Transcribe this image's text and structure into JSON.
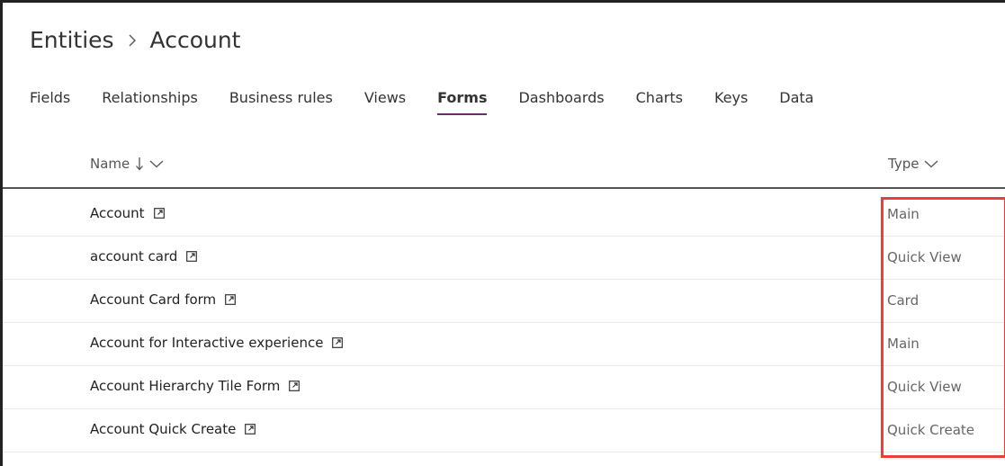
{
  "breadcrumb": {
    "root": "Entities",
    "current": "Account"
  },
  "tabs": [
    {
      "label": "Fields"
    },
    {
      "label": "Relationships"
    },
    {
      "label": "Business rules"
    },
    {
      "label": "Views"
    },
    {
      "label": "Forms"
    },
    {
      "label": "Dashboards"
    },
    {
      "label": "Charts"
    },
    {
      "label": "Keys"
    },
    {
      "label": "Data"
    }
  ],
  "active_tab": "Forms",
  "table": {
    "columns": {
      "name": "Name",
      "type": "Type"
    },
    "rows": [
      {
        "name": "Account",
        "type": "Main"
      },
      {
        "name": "account card",
        "type": "Quick View"
      },
      {
        "name": "Account Card form",
        "type": "Card"
      },
      {
        "name": "Account for Interactive experience",
        "type": "Main"
      },
      {
        "name": "Account Hierarchy Tile Form",
        "type": "Quick View"
      },
      {
        "name": "Account Quick Create",
        "type": "Quick Create"
      }
    ]
  },
  "colors": {
    "active_tab_underline": "#742774",
    "highlight_border": "#e8403c"
  },
  "icons": {
    "breadcrumb_separator": "chevron-right-icon",
    "sort": "arrow-down-icon",
    "column_menu": "chevron-down-icon",
    "open_external": "open-in-new-window-icon"
  }
}
